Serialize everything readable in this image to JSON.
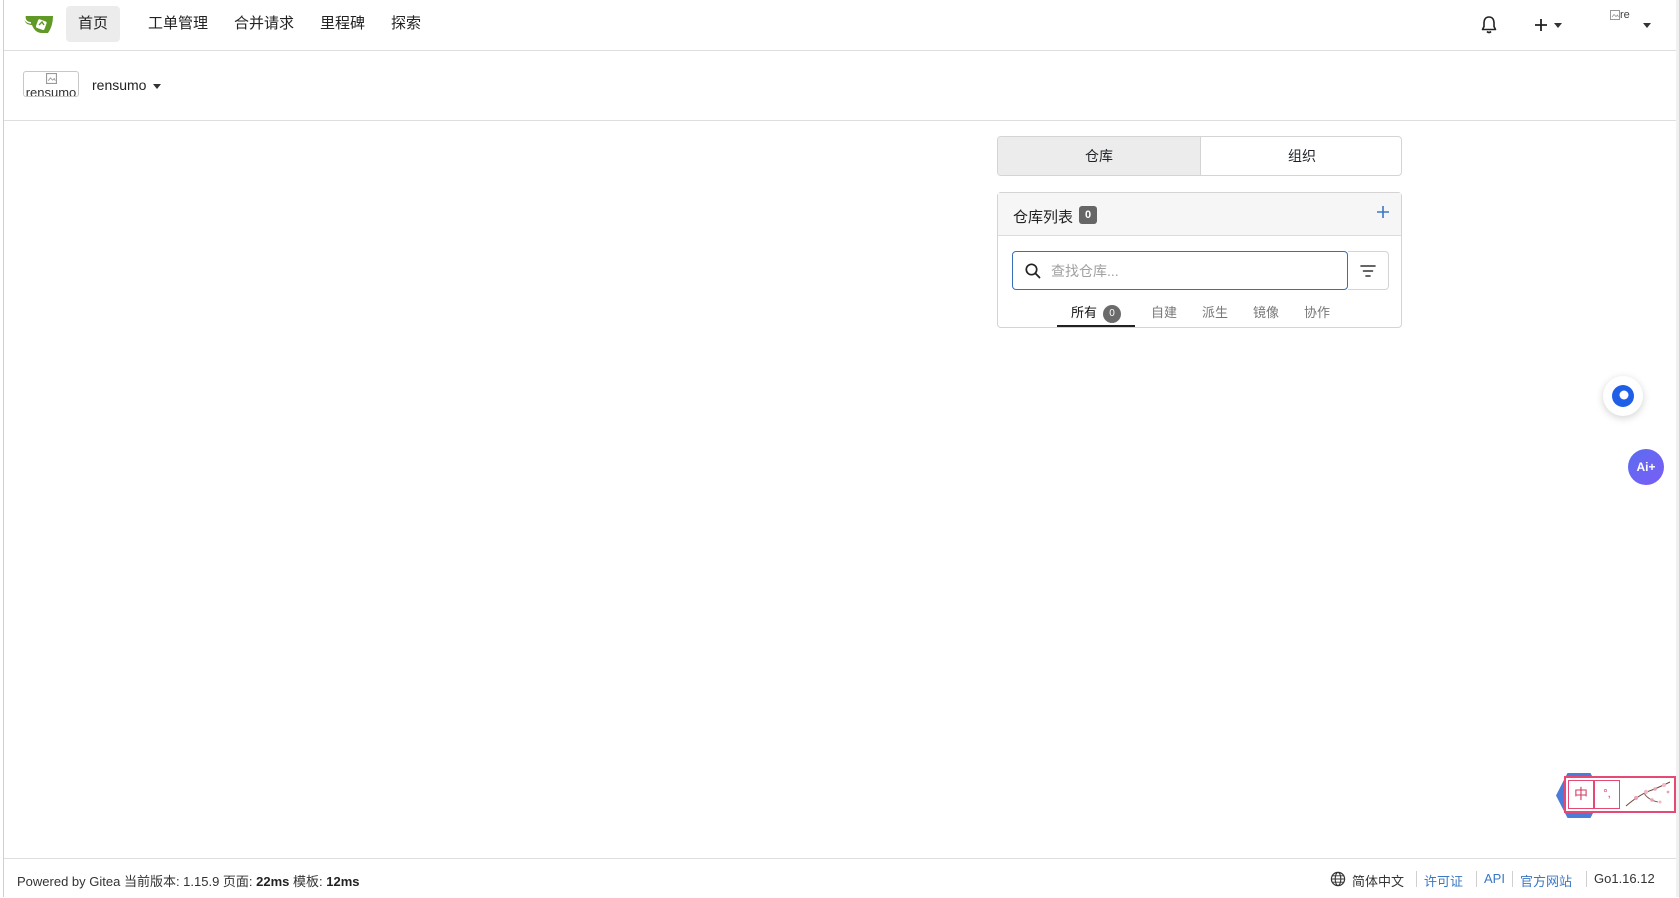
{
  "navbar": {
    "items": [
      {
        "label": "首页",
        "active": true
      },
      {
        "label": "工单管理",
        "active": false
      },
      {
        "label": "合并请求",
        "active": false
      },
      {
        "label": "里程碑",
        "active": false
      },
      {
        "label": "探索",
        "active": false
      }
    ],
    "avatar_alt": "r‌e"
  },
  "context": {
    "avatar_alt": "rensumo",
    "username": "rensumo"
  },
  "dashboard": {
    "tabs": [
      {
        "label": "仓库",
        "active": true
      },
      {
        "label": "组织",
        "active": false
      }
    ],
    "repo_box": {
      "title": "仓库列表",
      "count": "0",
      "search_placeholder": "查找仓库...",
      "filters": [
        {
          "label": "所有",
          "count": "0",
          "active": true
        },
        {
          "label": "自建",
          "active": false
        },
        {
          "label": "派生",
          "active": false
        },
        {
          "label": "镜像",
          "active": false
        },
        {
          "label": "协作",
          "active": false
        }
      ]
    }
  },
  "floating": {
    "ai_label": "Ai+",
    "ime_char": "中",
    "ime_punct": "°,"
  },
  "footer": {
    "powered_prefix": "Powered by Gitea 当前版本: 1.15.9 页面: ",
    "page_time": "22ms",
    "template_prefix": " 模板: ",
    "template_time": "12ms",
    "language": "简体中文",
    "license": "许可证",
    "api": "API",
    "website": "官方网站",
    "go_version": "Go1.16.12"
  },
  "colors": {
    "logo_green": "#609926",
    "link_blue": "#3b78c2",
    "search_focus_border": "#3a6fb8"
  }
}
